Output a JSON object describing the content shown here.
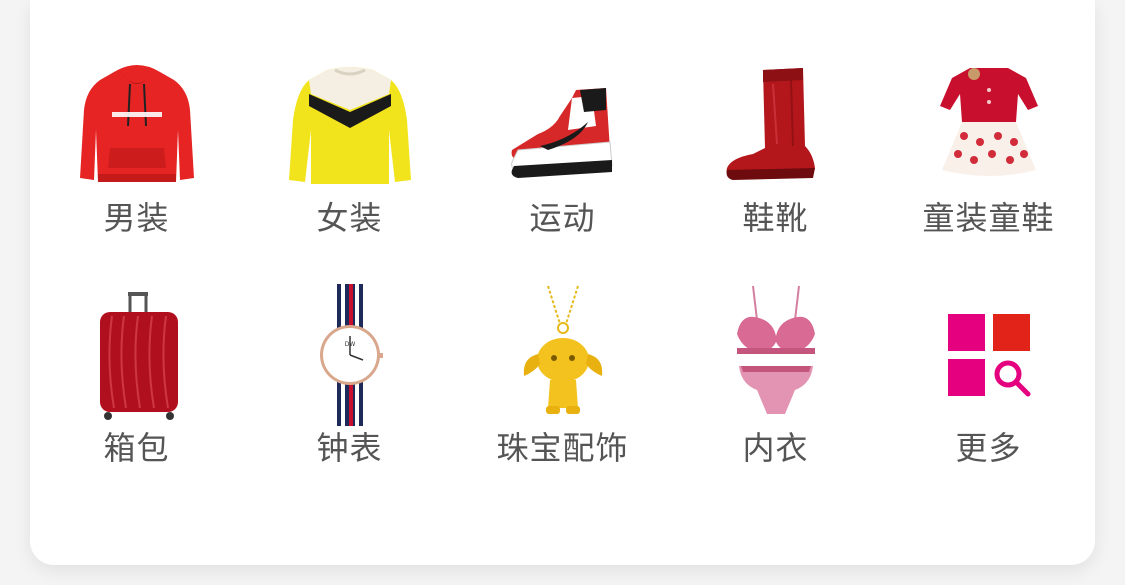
{
  "categories": [
    {
      "label": "男装",
      "icon": "red-hoodie-icon"
    },
    {
      "label": "女装",
      "icon": "yellow-sweater-icon"
    },
    {
      "label": "运动",
      "icon": "sneaker-icon"
    },
    {
      "label": "鞋靴",
      "icon": "red-boot-icon"
    },
    {
      "label": "童装童鞋",
      "icon": "kids-dress-icon"
    },
    {
      "label": "箱包",
      "icon": "luggage-icon"
    },
    {
      "label": "钟表",
      "icon": "watch-icon"
    },
    {
      "label": "珠宝配饰",
      "icon": "gold-pendant-icon"
    },
    {
      "label": "内衣",
      "icon": "lingerie-icon"
    },
    {
      "label": "更多",
      "icon": "more-grid-search-icon"
    }
  ],
  "colors": {
    "label_text": "#555555",
    "accent_red": "#e1251b",
    "accent_magenta": "#e4007f"
  }
}
